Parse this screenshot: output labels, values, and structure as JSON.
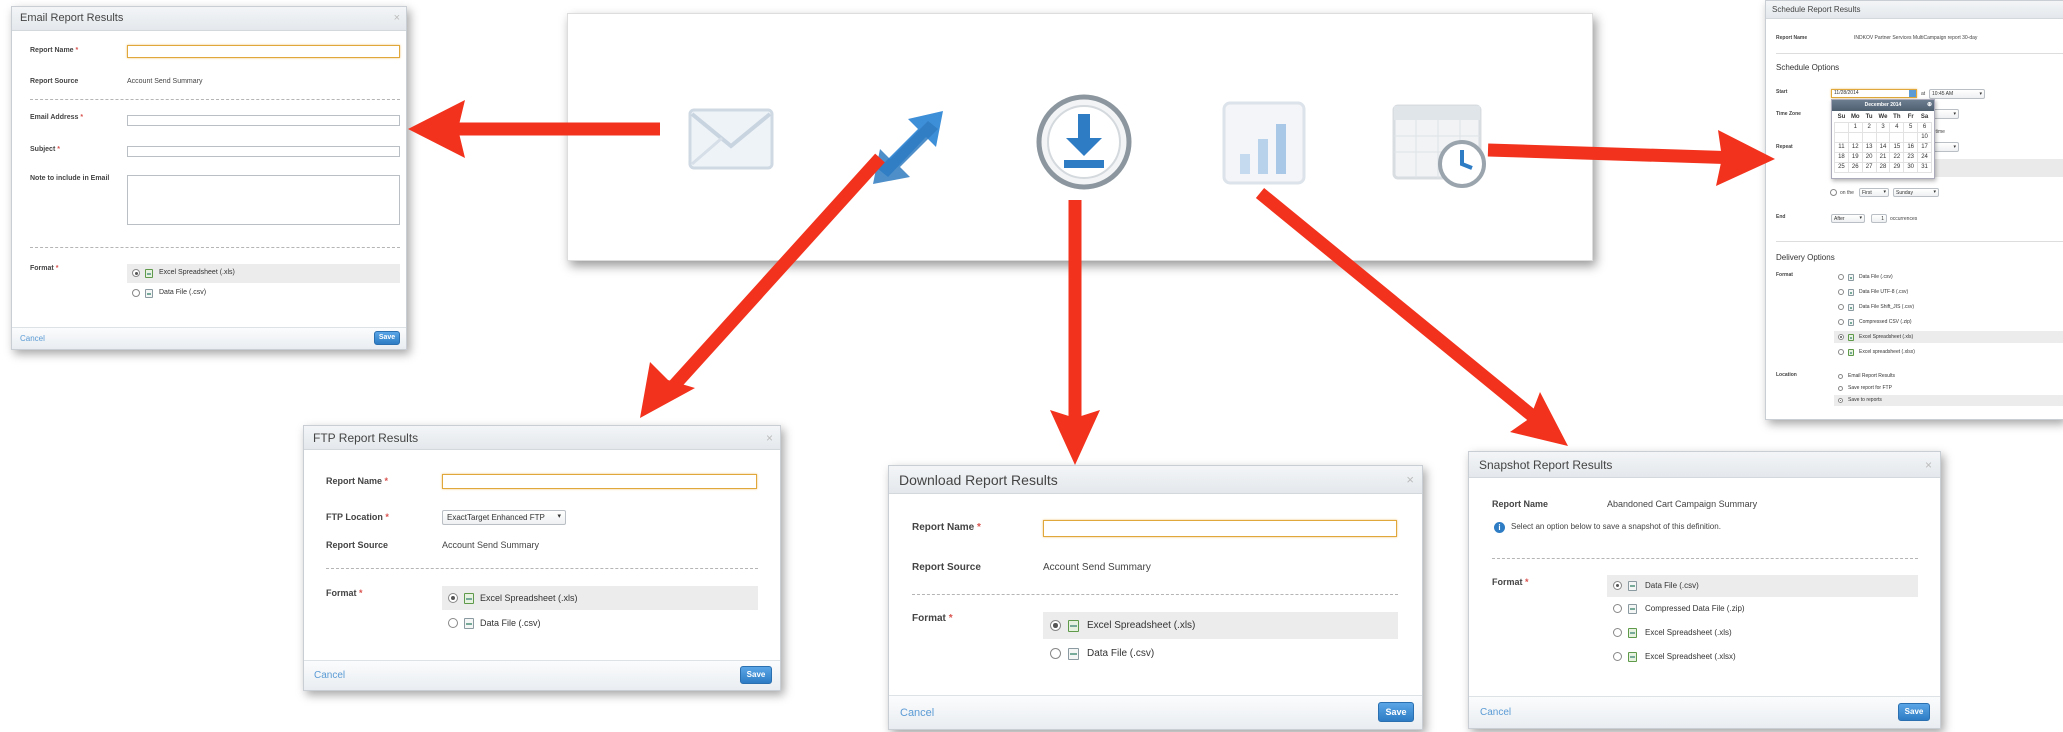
{
  "email": {
    "title": "Email Report Results",
    "close": "×",
    "report_name_label": "Report Name",
    "report_source_label": "Report Source",
    "report_source_value": "Account Send Summary",
    "email_label": "Email Address",
    "subject_label": "Subject",
    "note_label": "Note to include in Email",
    "format_label": "Format",
    "req": "*",
    "options": [
      "Excel Spreadsheet (.xls)",
      "Data File (.csv)"
    ],
    "cancel": "Cancel",
    "save": "Save"
  },
  "ftp": {
    "title": "FTP Report Results",
    "close": "×",
    "report_name_label": "Report Name",
    "ftp_location_label": "FTP Location",
    "ftp_location_value": "ExactTarget Enhanced FTP",
    "report_source_label": "Report Source",
    "report_source_value": "Account Send Summary",
    "format_label": "Format",
    "req": "*",
    "options": [
      "Excel Spreadsheet (.xls)",
      "Data File (.csv)"
    ],
    "cancel": "Cancel",
    "save": "Save"
  },
  "download": {
    "title": "Download Report Results",
    "close": "×",
    "report_name_label": "Report Name",
    "report_source_label": "Report Source",
    "report_source_value": "Account Send Summary",
    "format_label": "Format",
    "req": "*",
    "options": [
      "Excel Spreadsheet (.xls)",
      "Data File (.csv)"
    ],
    "cancel": "Cancel",
    "save": "Save"
  },
  "snapshot": {
    "title": "Snapshot Report Results",
    "close": "×",
    "report_name_label": "Report Name",
    "report_name_value": "Abandoned Cart Campaign Summary",
    "info_text": "Select an option below to save a snapshot of this definition.",
    "format_label": "Format",
    "req": "*",
    "options": [
      "Data File (.csv)",
      "Compressed Data File (.zip)",
      "Excel Spreadsheet (.xls)",
      "Excel Spreadsheet (.xlsx)"
    ],
    "cancel": "Cancel",
    "save": "Save"
  },
  "schedule": {
    "title": "Schedule Report Results",
    "report_name_label": "Report Name",
    "report_name_value": "INDKOV Partner Services MultiCampaign report 30-day",
    "schedule_options": "Schedule Options",
    "start_label": "Start",
    "start_date": "11/28/2014",
    "at": "at",
    "start_time": "10:45 AM",
    "timezone_label": "Time Zone",
    "savings_text": "ngs time",
    "repeat_label": "Repeat",
    "calendar_month": "December 2014",
    "weekdays": [
      "Su",
      "Mo",
      "Tu",
      "We",
      "Th",
      "Fr",
      "Sa"
    ],
    "weeks": [
      [
        "",
        "1",
        "2",
        "3",
        "4",
        "5",
        "6"
      ],
      [
        "",
        "",
        "",
        "",
        "",
        "",
        "10"
      ],
      [
        "11",
        "12",
        "13",
        "14",
        "15",
        "16",
        "17"
      ],
      [
        "18",
        "19",
        "20",
        "21",
        "22",
        "23",
        "24"
      ],
      [
        "25",
        "26",
        "27",
        "28",
        "29",
        "30",
        "31"
      ]
    ],
    "on_the": "on the",
    "first": "First",
    "sunday": "Sunday",
    "end_label": "End",
    "end_after": "After",
    "end_count": "1",
    "occurrences": "occurrences",
    "delivery_options": "Delivery Options",
    "format_label": "Format",
    "formats": [
      "Data File (.csv)",
      "Data File UTF-8 (.csv)",
      "Data File Shift_JIS (.csv)",
      "Compressed CSV (.zip)",
      "Excel Spreadsheet (.xls)",
      "Excel spreadsheet (.xlsx)"
    ],
    "location_label": "Location",
    "locations": [
      "Email Report Results",
      "Save report for FTP",
      "Save to reports"
    ]
  }
}
